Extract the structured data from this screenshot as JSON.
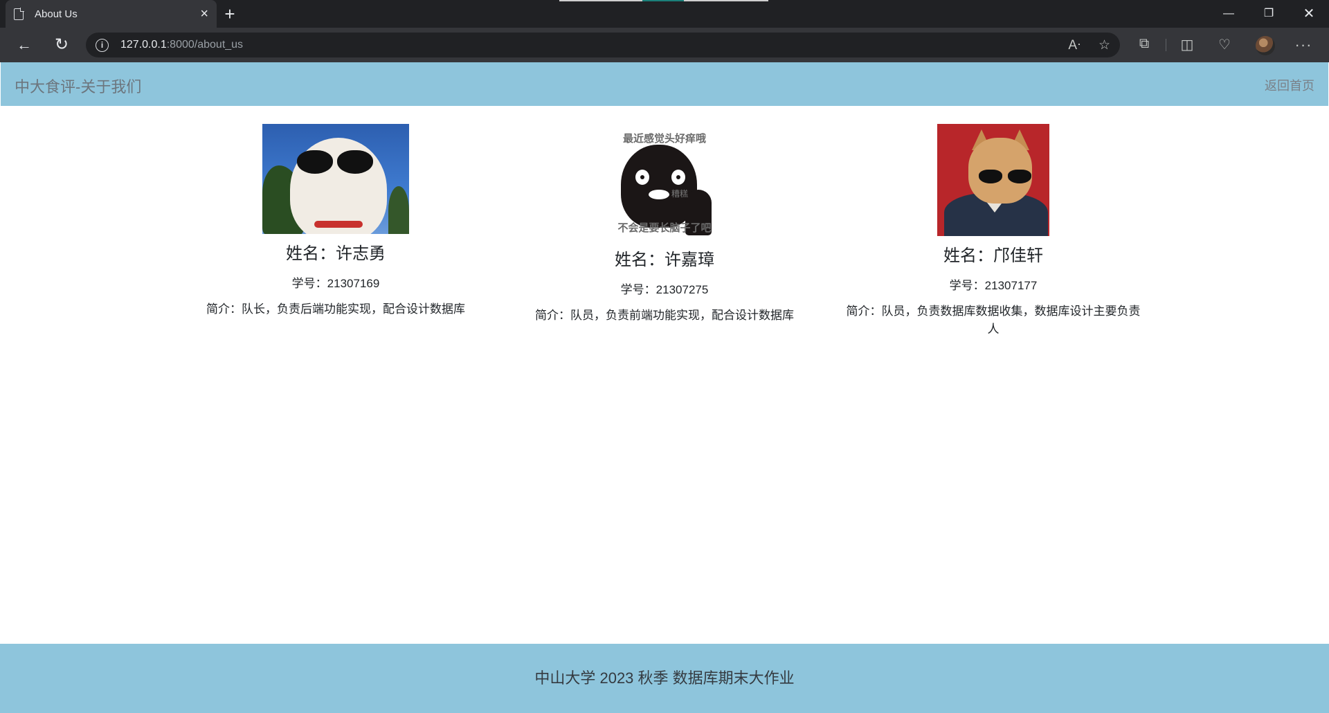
{
  "browser": {
    "tab_title": "About Us",
    "tab_close": "×",
    "new_tab": "+",
    "url_host": "127.0.0.1",
    "url_path": ":8000/about_us",
    "window_min": "—",
    "window_max": "❐",
    "window_close": "✕"
  },
  "navbar": {
    "brand": "中大食评-关于我们",
    "home_link": "返回首页"
  },
  "members": [
    {
      "name": "姓名：许志勇",
      "student_id": "学号：21307169",
      "intro": "简介：队长，负责后端功能实现，配合设计数据库",
      "photo": "cat-with-sunglasses"
    },
    {
      "name": "姓名：许嘉璋",
      "student_id": "学号：21307275",
      "intro": "简介：队员，负责前端功能实现，配合设计数据库",
      "photo": "penguin-meme",
      "photo_text_top": "最近感觉头好痒哦",
      "photo_text_mid": "糟糕",
      "photo_text_bottom": "不会是要长脑子了吧"
    },
    {
      "name": "姓名：邝佳轩",
      "student_id": "学号：21307177",
      "intro": "简介：队员，负责数据库数据收集，数据库设计主要负责人",
      "photo": "dog-in-suit-with-sunglasses"
    }
  ],
  "footer": {
    "text": "中山大学 2023 秋季 数据库期末大作业"
  },
  "colors": {
    "navbar_bg": "#8ec5dc",
    "footer_bg": "#8ec5dc",
    "browser_dark": "#35363a"
  }
}
